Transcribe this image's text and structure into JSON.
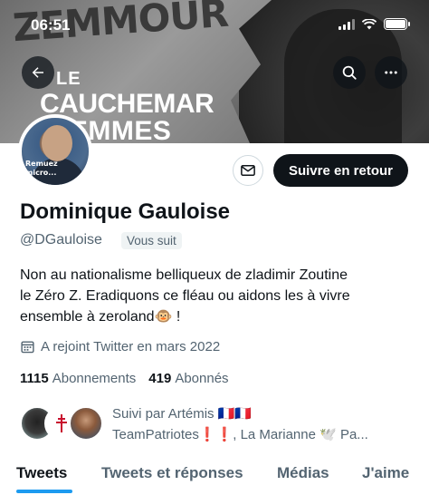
{
  "status_bar": {
    "time": "06:51"
  },
  "banner": {
    "line_top": "ZEMMOUR",
    "line_le": "LE",
    "line_cauchemar": "CAUCHEMAR",
    "line_femmes": "FEMMES"
  },
  "header": {
    "back_icon": "arrow-left-icon",
    "search_icon": "search-icon",
    "more_icon": "more-icon"
  },
  "avatar": {
    "caption_line1": "Remuez",
    "caption_line2": "micro..."
  },
  "actions": {
    "dm_icon": "envelope-icon",
    "follow_back_label": "Suivre en retour"
  },
  "profile": {
    "display_name": "Dominique Gauloise",
    "handle": "@DGauloise",
    "follows_you_badge": "Vous suit",
    "bio_line1": "Non au nationalisme belliqueux de zladimir Zoutine",
    "bio_line2": "le Zéro Z. Eradiquons ce fléau ou aidons les à vivre",
    "bio_line3": "ensemble à zeroland🐵 !",
    "joined": "A rejoint Twitter en mars 2022"
  },
  "stats": {
    "following_count": "1115",
    "following_label": "Abonnements",
    "followers_count": "419",
    "followers_label": "Abonnés"
  },
  "followed_by": {
    "line1": "Suivi par Artémis 🇫🇷🇫🇷",
    "line2": "TeamPatriotes❗❗, La Marianne 🕊️ Pa..."
  },
  "tabs": [
    {
      "label": "Tweets"
    },
    {
      "label": "Tweets et réponses"
    },
    {
      "label": "Médias"
    },
    {
      "label": "J'aime"
    }
  ],
  "colors": {
    "accent": "#1d9bf0",
    "text": "#0f1419",
    "muted": "#536471",
    "button_dark": "#0f1419"
  }
}
